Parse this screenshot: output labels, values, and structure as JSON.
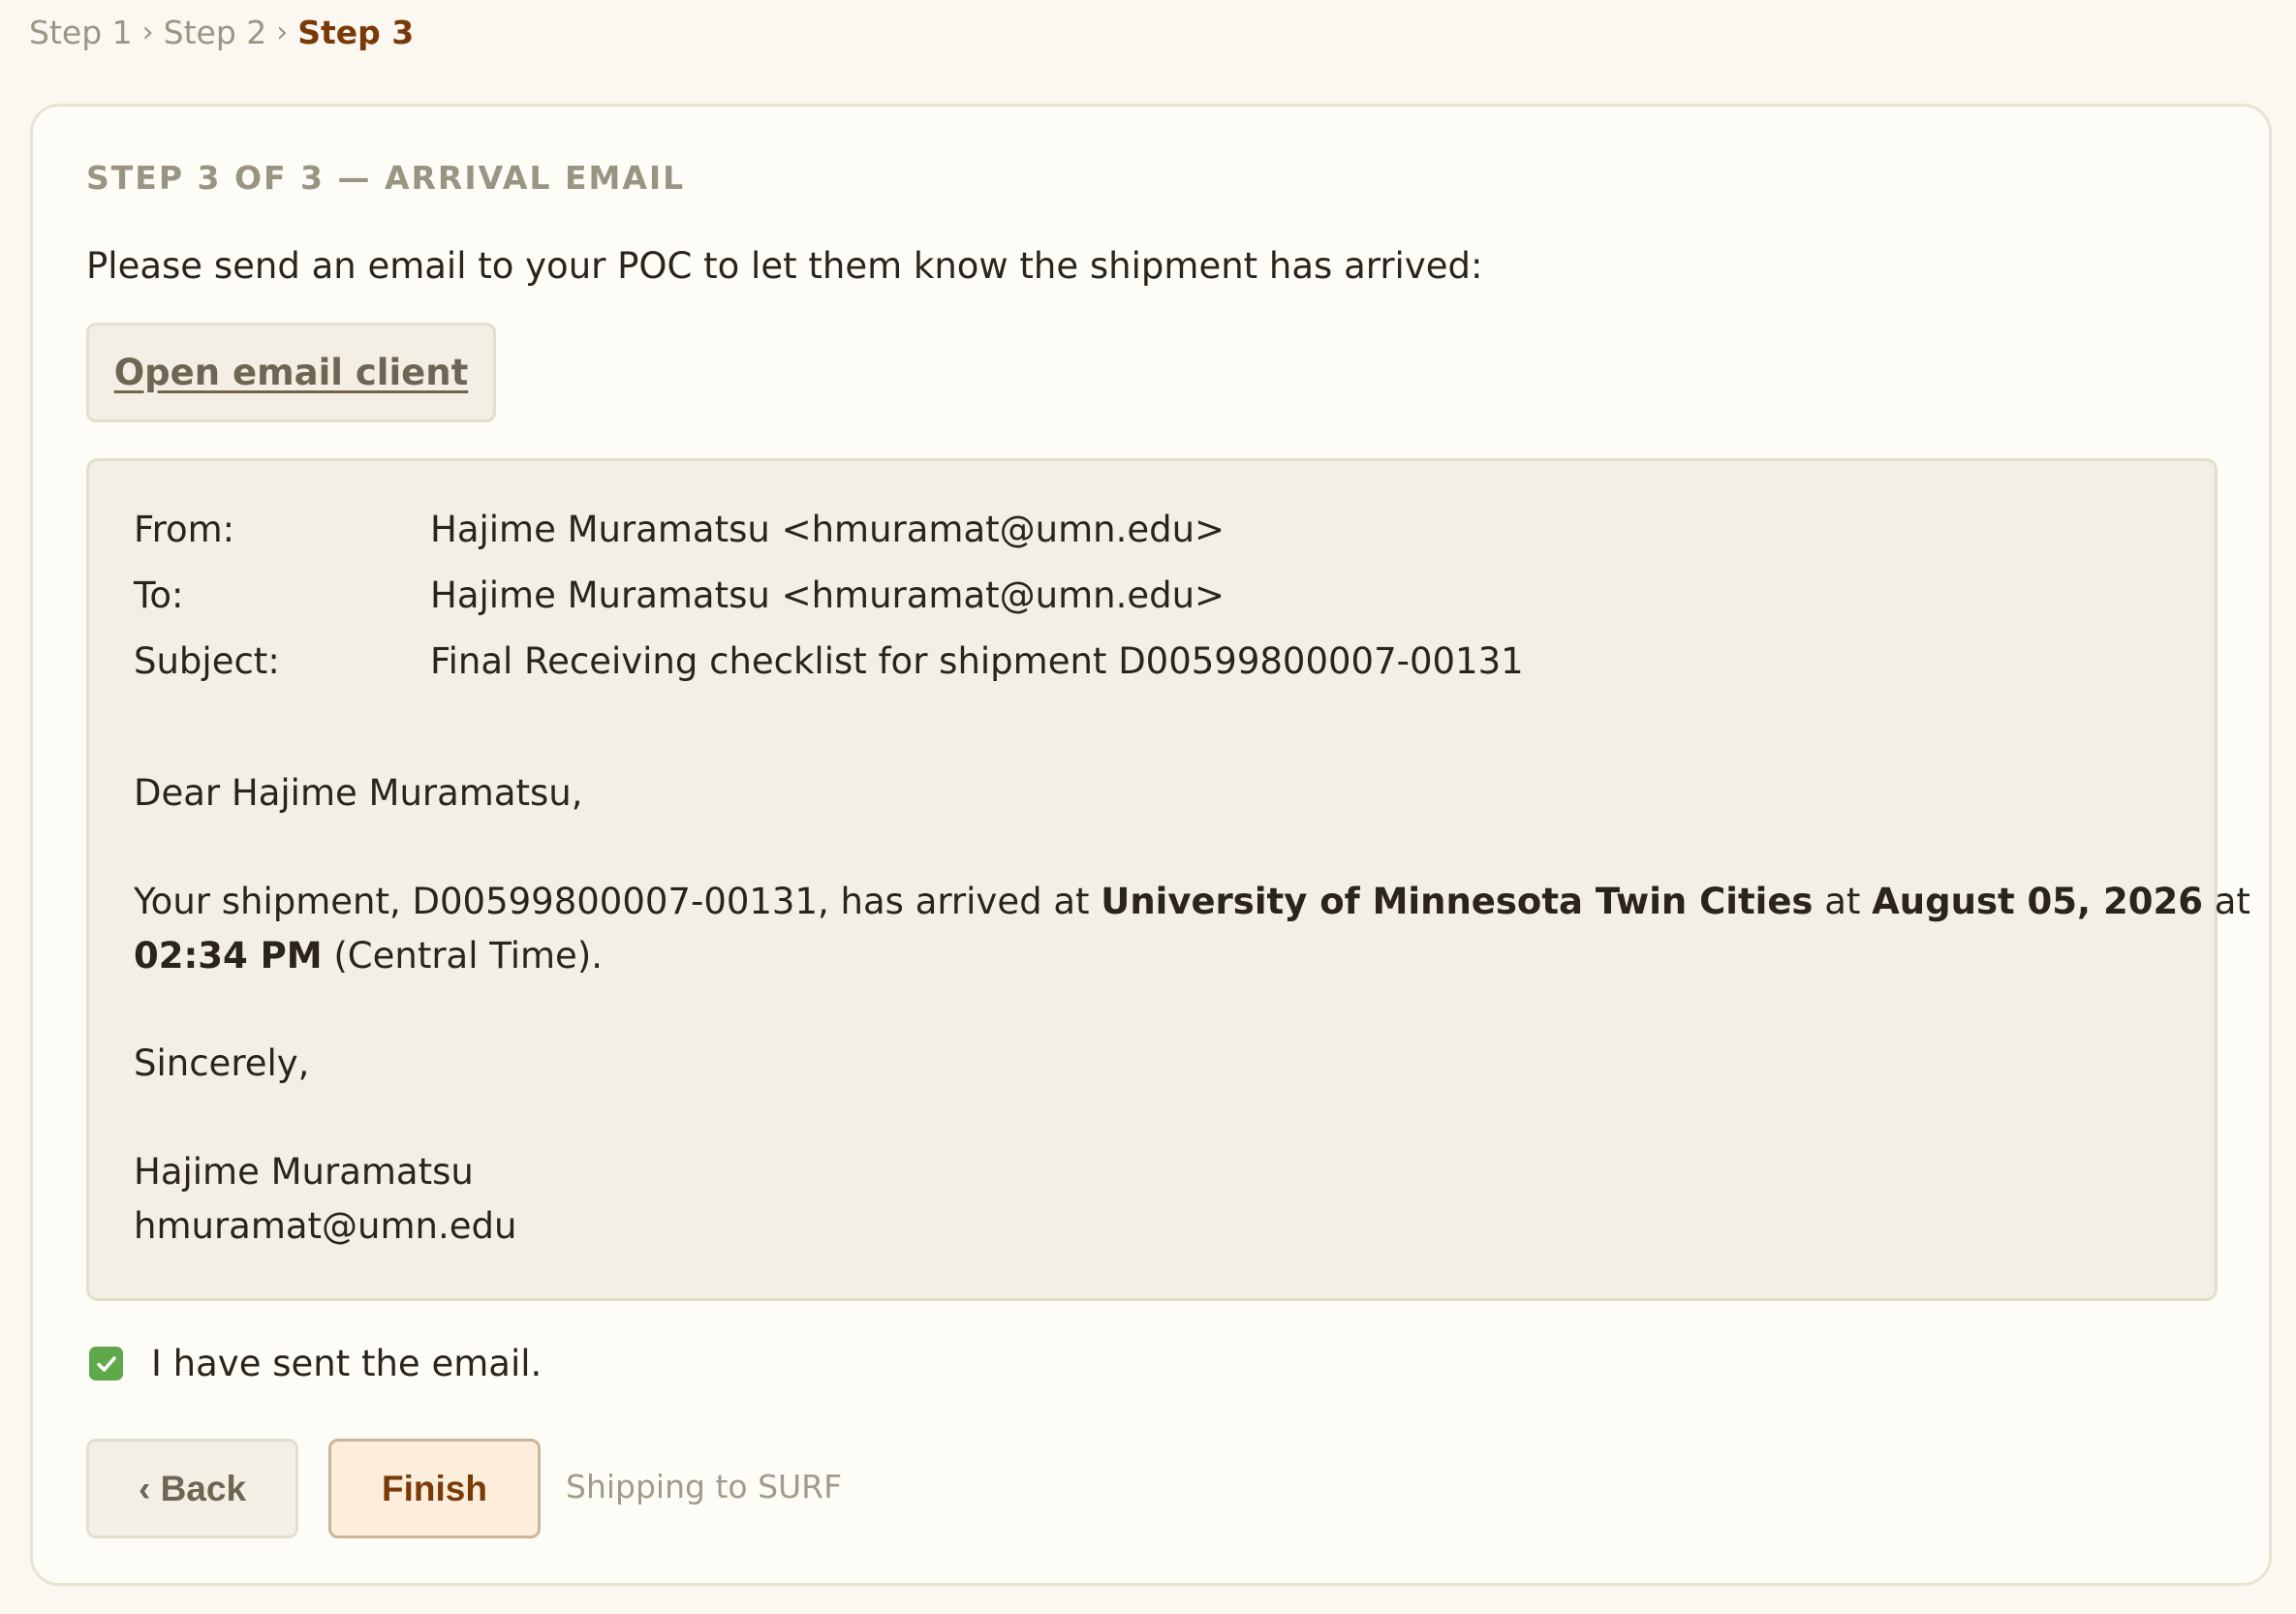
{
  "breadcrumb": {
    "items": [
      "Step 1",
      "Step 2"
    ],
    "separator": "›",
    "current": "Step 3"
  },
  "card": {
    "heading": "STEP 3 OF 3 — ARRIVAL EMAIL",
    "instruction": "Please send an email to your POC to let them know the shipment has arrived:",
    "open_email_label": "Open email client"
  },
  "email": {
    "from_label": "From:",
    "from_value": "Hajime Muramatsu <hmuramat@umn.edu>",
    "to_label": "To:",
    "to_value": "Hajime Muramatsu <hmuramat@umn.edu>",
    "subject_label": "Subject:",
    "subject_value": "Final Receiving checklist for shipment D00599800007-00131",
    "greeting": "Dear Hajime Muramatsu,",
    "body_prefix": "Your shipment, D00599800007-00131, has arrived at ",
    "body_institution": "University of Minnesota Twin Cities",
    "body_at1": " at ",
    "body_date": "August 05, 2026",
    "body_at2": " at",
    "body_time": "02:34 PM",
    "body_suffix": " (Central Time).",
    "closing": "Sincerely,",
    "signature_name": "Hajime Muramatsu",
    "signature_email": "hmuramat@umn.edu"
  },
  "confirm": {
    "label": "I have sent the email.",
    "checked": true
  },
  "actions": {
    "back_label": "‹ Back",
    "finish_label": "Finish",
    "note": "Shipping to SURF"
  },
  "colors": {
    "accent": "#7a3a08",
    "check": "#5fa84b"
  }
}
